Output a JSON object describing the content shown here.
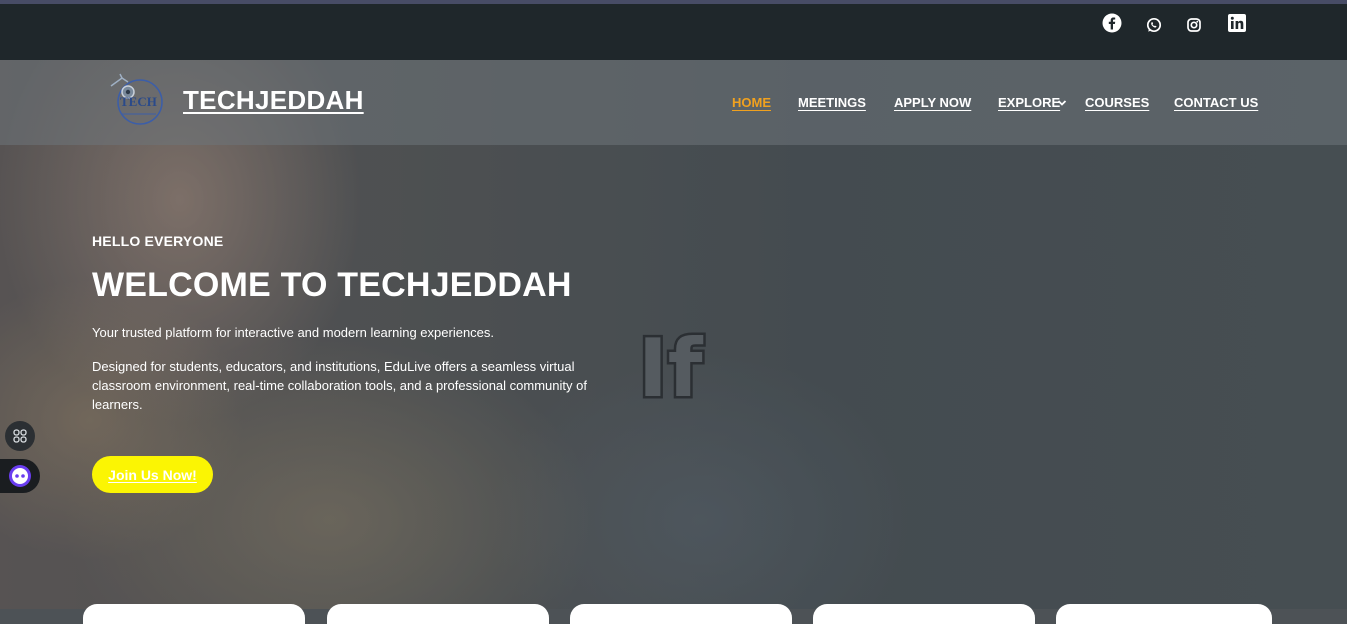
{
  "topbar": {
    "social": [
      {
        "name": "facebook-icon"
      },
      {
        "name": "whatsapp-icon"
      },
      {
        "name": "instagram-icon"
      },
      {
        "name": "linkedin-icon"
      }
    ]
  },
  "header": {
    "logo_text": "TECH",
    "brand": "TECHJEDDAH"
  },
  "nav": {
    "items": [
      {
        "label": "HOME",
        "active": true
      },
      {
        "label": "MEETINGS"
      },
      {
        "label": "APPLY NOW"
      },
      {
        "label": "EXPLORE"
      },
      {
        "label": "COURSES"
      },
      {
        "label": "CONTACT US"
      }
    ]
  },
  "hero": {
    "eyebrow": "HELLO EVERYONE",
    "title": "WELCOME TO TECHJEDDAH",
    "intro": "Your trusted platform for interactive and modern learning experiences.",
    "description": "Designed for students, educators, and institutions, EduLive offers a seamless virtual classroom environment, real-time collaboration tools, and a professional community of learners.",
    "cta": "Join Us Now!",
    "sticker": "If"
  },
  "colors": {
    "accent": "#f0a11f",
    "cta": "#fbf503",
    "topbar": "#1f272b"
  }
}
